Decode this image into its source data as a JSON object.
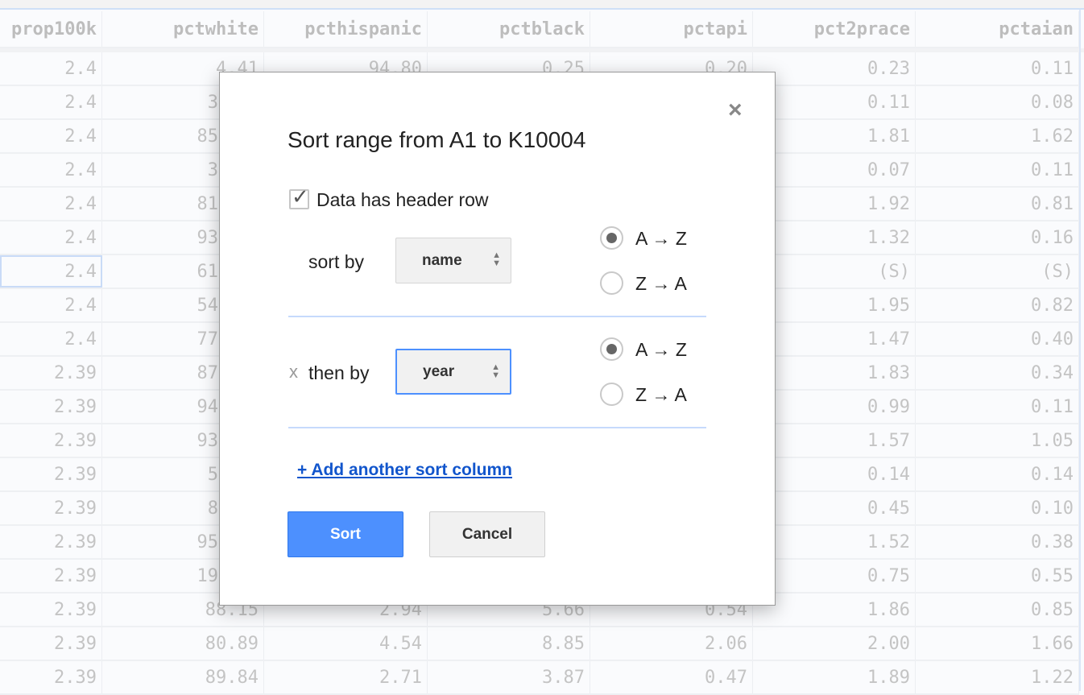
{
  "sheet": {
    "columns": [
      "prop100k",
      "pctwhite",
      "pcthispanic",
      "pctblack",
      "pctapi",
      "pct2prace",
      "pctaian"
    ],
    "rows": [
      [
        "2.4",
        "4.41",
        "94.80",
        "0.25",
        "0.20",
        "0.23",
        "0.11"
      ],
      [
        "2.4",
        "3",
        "",
        "",
        "",
        "0.11",
        "0.08"
      ],
      [
        "2.4",
        "85",
        "",
        "",
        "",
        "1.81",
        "1.62"
      ],
      [
        "2.4",
        "3",
        "",
        "",
        "",
        "0.07",
        "0.11"
      ],
      [
        "2.4",
        "81",
        "",
        "",
        "",
        "1.92",
        "0.81"
      ],
      [
        "2.4",
        "93",
        "",
        "",
        "",
        "1.32",
        "0.16"
      ],
      [
        "2.4",
        "61",
        "",
        "",
        "",
        "(S)",
        "(S)"
      ],
      [
        "2.4",
        "54",
        "",
        "",
        "",
        "1.95",
        "0.82"
      ],
      [
        "2.4",
        "77",
        "",
        "",
        "",
        "1.47",
        "0.40"
      ],
      [
        "2.39",
        "87",
        "",
        "",
        "",
        "1.83",
        "0.34"
      ],
      [
        "2.39",
        "94",
        "",
        "",
        "",
        "0.99",
        "0.11"
      ],
      [
        "2.39",
        "93",
        "",
        "",
        "",
        "1.57",
        "1.05"
      ],
      [
        "2.39",
        "5",
        "",
        "",
        "",
        "0.14",
        "0.14"
      ],
      [
        "2.39",
        "8",
        "",
        "",
        "",
        "0.45",
        "0.10"
      ],
      [
        "2.39",
        "95",
        "",
        "",
        "",
        "1.52",
        "0.38"
      ],
      [
        "2.39",
        "19",
        "",
        "",
        "",
        "0.75",
        "0.55"
      ],
      [
        "2.39",
        "88.15",
        "2.94",
        "5.66",
        "0.54",
        "1.86",
        "0.85"
      ],
      [
        "2.39",
        "80.89",
        "4.54",
        "8.85",
        "2.06",
        "2.00",
        "1.66"
      ],
      [
        "2.39",
        "89.84",
        "2.71",
        "3.87",
        "0.47",
        "1.89",
        "1.22"
      ]
    ]
  },
  "dialog": {
    "close_icon": "×",
    "title": "Sort range from A1 to K10004",
    "header_checkbox": {
      "label": "Data has header row",
      "checked": true,
      "mark": "✓"
    },
    "sort_by": {
      "label": "sort by",
      "value": "name",
      "order": "A → Z",
      "options": [
        "A → Z",
        "Z → A"
      ]
    },
    "then_by": {
      "remove": "x",
      "label": "then by",
      "value": "year",
      "order": "A → Z",
      "options": [
        "A → Z",
        "Z → A"
      ]
    },
    "select_arrows": "▲\n▼",
    "add_link": "+ Add another sort column",
    "sort_button": "Sort",
    "cancel_button": "Cancel",
    "accent": "#4d90fe"
  }
}
